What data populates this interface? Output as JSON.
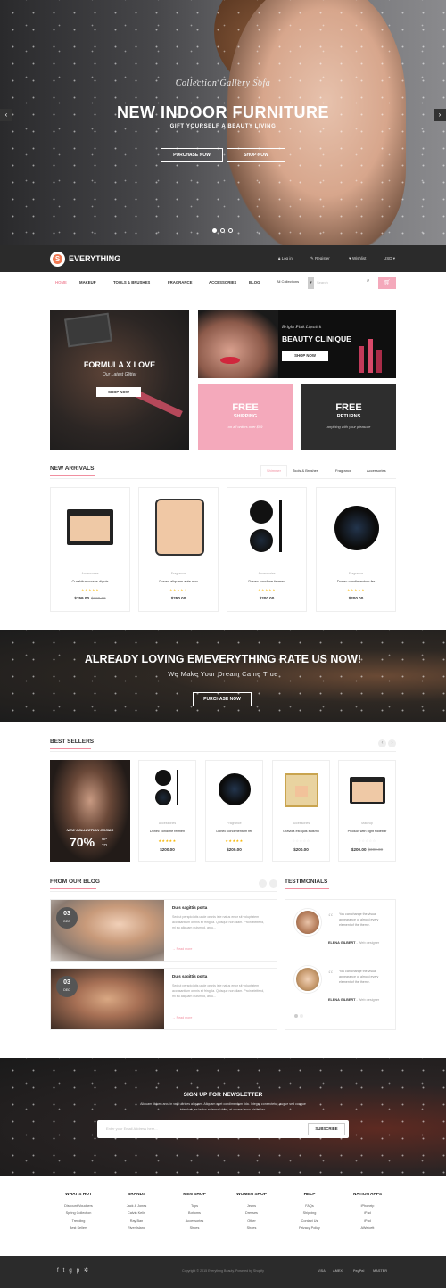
{
  "hero": {
    "script_title": "Collection Gallery Sofa",
    "heading": "NEW INDOOR FURNITURE",
    "subheading": "GIFT YOURSELF A BEAUTY LIVING",
    "btn_primary": "PURCHASE NOW",
    "btn_secondary": "SHOP NOW",
    "prev_icon": "‹",
    "next_icon": "›"
  },
  "header": {
    "logo_letter": "S",
    "brand": "EVERYTHING",
    "login": "Log in",
    "register": "Register",
    "wishlist": "Wishlist",
    "currency": "USD ▾"
  },
  "nav": {
    "items": [
      "HOME",
      "MAKEUP",
      "TOOLS & BRUSHES",
      "FRAGRANCE",
      "ACCESSORIES",
      "BLOG"
    ],
    "collections_select": "All Collections",
    "search_placeholder": "Search"
  },
  "promo": {
    "big_title": "FORMULA X LOVE",
    "big_sub": "Our Latest Glitter",
    "big_btn": "SHOP NOW",
    "lipstick_tag": "Bright Pink Lipstick",
    "lipstick_title": "BEAUTY CLINIQUE",
    "lipstick_btn": "SHOP NOW",
    "free_shipping_1": "FREE",
    "free_shipping_2": "SHIPPING",
    "free_shipping_sub": "on all orders over $99",
    "free_returns_1": "FREE",
    "free_returns_2": "RETURNS",
    "free_returns_sub": "anything with your pleasure"
  },
  "new_arrivals": {
    "title": "NEW ARRIVALS",
    "tabs": [
      "Shimmer",
      "Tools & Brushes",
      "Fragrance",
      "Accessories"
    ],
    "products": [
      {
        "cat": "Accessories",
        "name": "Curabitur cursus dignis",
        "price": "$259.00",
        "old": "$300.00",
        "stars": "★★★★★"
      },
      {
        "cat": "Fragrance",
        "name": "Donec aliquam ante non",
        "price": "$250.00",
        "old": "",
        "stars": "★★★★☆"
      },
      {
        "cat": "Accessories",
        "name": "Donec condime fermen",
        "price": "$200.00",
        "old": "",
        "stars": "★★★★★"
      },
      {
        "cat": "Fragrance",
        "name": "Donec condimentum fer",
        "price": "$200.00",
        "old": "",
        "stars": "★★★★★"
      }
    ]
  },
  "rate_banner": {
    "title": "ALREADY LOVING EMEVERYTHING RATE US NOW!",
    "sub": "We Make Your Dream Came True",
    "btn": "PURCHASE NOW"
  },
  "best_sellers": {
    "title": "BEST SELLERS",
    "promo_line": "NEW COLLECTION COSMO",
    "promo_pct": "70%",
    "promo_up": "UP",
    "promo_to": "TO",
    "products": [
      {
        "cat": "Accessories",
        "name": "Donec condime fermen",
        "price": "$200.00",
        "old": "",
        "stars": "★★★★★"
      },
      {
        "cat": "Fragrance",
        "name": "Donec condimentum fer",
        "price": "$200.00",
        "old": "",
        "stars": "★★★★★"
      },
      {
        "cat": "Accessories",
        "name": "Gravida est quis euismo",
        "price": "$200.00",
        "old": "",
        "stars": "☆☆☆☆☆"
      },
      {
        "cat": "Makeup",
        "name": "Product with right slidebar",
        "price": "$200.00",
        "old": "$300.00",
        "stars": "☆☆☆☆☆"
      }
    ]
  },
  "blog": {
    "title": "FROM OUR BLOG",
    "posts": [
      {
        "day": "03",
        "month": "DEC",
        "title": "Duis sagittis porta",
        "excerpt": "Sed ut perspiciatis unde omnis iste natus error sit voluptatem accusantium omnis et fringilla. Quisque non diam. Proin eleifend, mi eu aliquam euismod, arcu...",
        "more": "→ Read more"
      },
      {
        "day": "03",
        "month": "DEC",
        "title": "Duis sagittis porta",
        "excerpt": "Sed ut perspiciatis unde omnis iste natus error sit voluptatem accusantium omnis et fringilla. Quisque non diam. Proin eleifend, mi eu aliquam euismod, arcu...",
        "more": "→ Read more"
      }
    ]
  },
  "testimonials": {
    "title": "TESTIMONIALS",
    "items": [
      {
        "quote": "You can change the visual appearance of almost every element of the theme.",
        "name": "ELENA GILBERT",
        "role": "- Web designer"
      },
      {
        "quote": "You can change the visual appearance of almost every element of the theme.",
        "name": "ELENA GILBERT",
        "role": "- Web designer"
      }
    ]
  },
  "newsletter": {
    "title": "SIGN UP FOR NEWSLETTER",
    "desc": "Aliquam tibicen arcu in velit ultrices aliquam. Aliquam eget condimentum fida. Integer consectetur, augue sed congue interdum, ex lectus euismod dolor, et ornare lacus nisl at leo.",
    "placeholder": "Enter your Email Address here...",
    "btn": "SUBSCRIBE"
  },
  "footer": {
    "columns": [
      {
        "title": "WHAT'S HOT",
        "items": [
          "Discount Vouchers",
          "Spring Collection",
          "Trending",
          "Best Sellers"
        ]
      },
      {
        "title": "BRANDS",
        "items": [
          "Jack & Jones",
          "Calvin Kelin",
          "Ray Ban",
          "River Island"
        ]
      },
      {
        "title": "MEN SHOP",
        "items": [
          "Tops",
          "Bottoms",
          "Accessories",
          "Shoes"
        ]
      },
      {
        "title": "WOMEN SHOP",
        "items": [
          "Jeans",
          "Dresses",
          "Other",
          "Shoes"
        ]
      },
      {
        "title": "HELP",
        "items": [
          "FAQs",
          "Shipping",
          "Contact Us",
          "Privacy Policy"
        ]
      },
      {
        "title": "NATION APPS",
        "items": [
          "iPhoneip",
          "iPad",
          "iPod",
          "AWelcett"
        ]
      }
    ],
    "copyright": "Copyright © 2015 Everything Beauty. Powered by Shopify",
    "payments": [
      "VISA",
      "AMEX",
      "PayPal",
      "MASTER"
    ]
  },
  "colors": {
    "accent": "#f18fa0",
    "dark": "#2b2b2b",
    "pink_tile": "#f4a9bb"
  }
}
